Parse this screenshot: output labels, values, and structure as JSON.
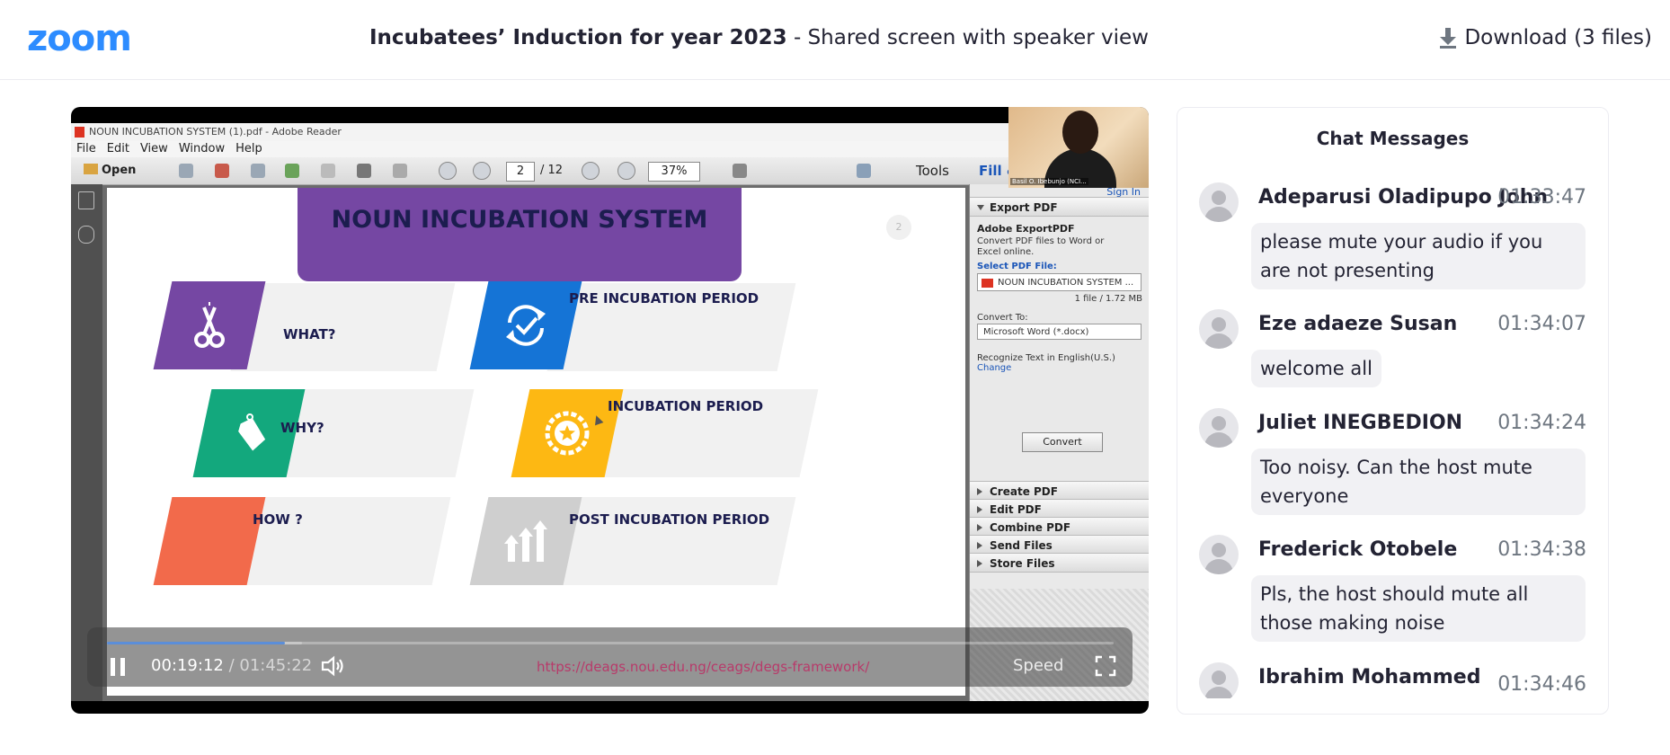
{
  "app": {
    "logo": "zoom",
    "meeting_title": "Incubatees’ Induction for year 2023",
    "view_suffix": " - Shared screen with speaker view",
    "download_label": "Download (3 files)"
  },
  "shared_screen": {
    "window_title": "NOUN INCUBATION SYSTEM (1).pdf - Adobe Reader",
    "menu": [
      "File",
      "Edit",
      "View",
      "Window",
      "Help"
    ],
    "toolbar": {
      "open_label": "Open",
      "current_page": "2",
      "total_pages": "/ 12",
      "zoom": "37%",
      "tools_label": "Tools",
      "fill_label": "Fill &"
    },
    "slide": {
      "title": "NOUN INCUBATION SYSTEM",
      "page_number": "2",
      "cards": [
        {
          "label": "WHAT?",
          "color": "#7547a3"
        },
        {
          "label": "PRE INCUBATION PERIOD",
          "color": "#1574d6"
        },
        {
          "label": "WHY?",
          "color": "#13a87d"
        },
        {
          "label": "INCUBATION PERIOD",
          "color": "#fdb813"
        },
        {
          "label": "HOW ?",
          "color": "#f26a4b"
        },
        {
          "label": "POST INCUBATION PERIOD",
          "color": "#cfcfcf"
        }
      ]
    },
    "right_pane": {
      "sign_in": "Sign In",
      "export_pdf": "Export PDF",
      "adobe_exportpdf": "Adobe ExportPDF",
      "description": "Convert PDF files to Word or Excel online.",
      "select_label": "Select PDF File:",
      "selected_file": "NOUN INCUBATION SYSTEM ...",
      "file_info": "1 file / 1.72 MB",
      "convert_to_label": "Convert To:",
      "convert_to_value": "Microsoft Word (*.docx)",
      "recognize_text": "Recognize Text in English(U.S.)",
      "change_link": "Change",
      "convert_button": "Convert",
      "sections": [
        "Create PDF",
        "Edit PDF",
        "Combine PDF",
        "Send Files",
        "Store Files"
      ]
    },
    "speaker_name": "Basil O. Ibebunjo (NCI..."
  },
  "player": {
    "current_time": "00:19:12",
    "total_time": "/ 01:45:22",
    "progress": 0.177,
    "buffered": 0.17,
    "overlay_url": "https://deags.nou.edu.ng/ceags/degs-framework/",
    "speed_label": "Speed"
  },
  "chat": {
    "title": "Chat Messages",
    "messages": [
      {
        "sender": "Adeparusi Oladipupo John",
        "time": "01:33:47",
        "text": "please mute your audio if you are not presenting"
      },
      {
        "sender": "Eze adaeze Susan",
        "time": "01:34:07",
        "text": "welcome all"
      },
      {
        "sender": "Juliet INEGBEDION",
        "time": "01:34:24",
        "text": "Too noisy. Can the host mute everyone"
      },
      {
        "sender": "Frederick Otobele",
        "time": "01:34:38",
        "text": "Pls, the host should mute all those making noise"
      },
      {
        "sender": "Ibrahim Mohammed",
        "time": "01:34:46",
        "text": ""
      }
    ]
  },
  "colors": {
    "zoom_blue": "#2D8CFF",
    "slide_banner": "#7547a3",
    "slide_text": "#1c1d4f",
    "progress": "#5b8ed9"
  }
}
